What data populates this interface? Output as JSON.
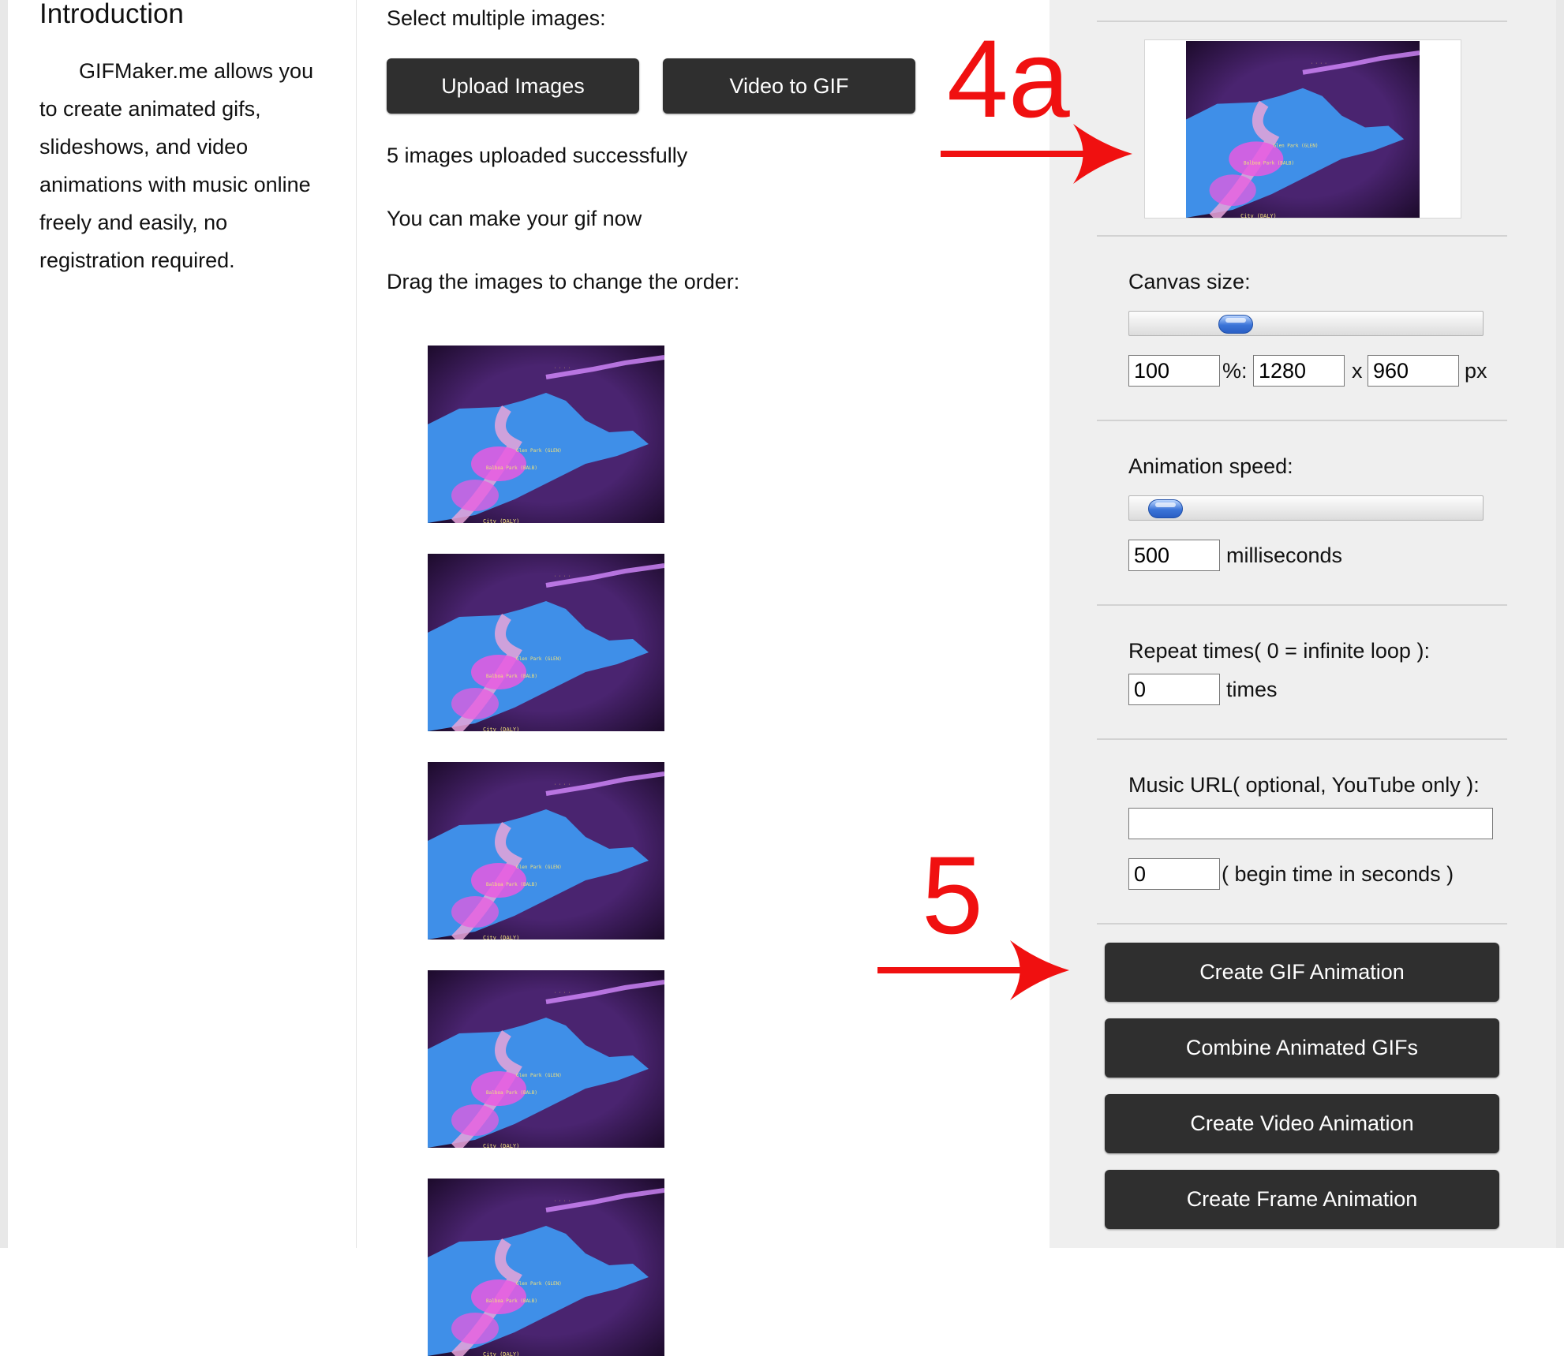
{
  "intro": {
    "heading": "Introduction",
    "text": "GIFMaker.me allows you to create animated gifs, slideshows, and video animations with music online freely and easily, no registration required."
  },
  "upload": {
    "select_label": "Select multiple images:",
    "upload_button": "Upload Images",
    "video_button": "Video to GIF",
    "status_success": "5 images uploaded successfully",
    "status_ready": "You can make your gif now",
    "drag_hint": "Drag the images to change the order:"
  },
  "thumbnails": {
    "count": 5,
    "labels": [
      "Glen Park (GLEN)",
      "Balboa Park (BALB)",
      "City (DALY)"
    ]
  },
  "settings": {
    "canvas_label": "Canvas size:",
    "canvas_percent": "100",
    "canvas_percent_suffix": "%:",
    "canvas_width": "1280",
    "canvas_x": "x",
    "canvas_height": "960",
    "canvas_unit": "px",
    "canvas_slider_value": 0.28,
    "speed_label": "Animation speed:",
    "speed_value": "500",
    "speed_unit": "milliseconds",
    "speed_slider_value": 0.06,
    "repeat_label": "Repeat times( 0 = infinite loop ):",
    "repeat_value": "0",
    "repeat_unit": "times",
    "music_label": "Music URL( optional, YouTube only ):",
    "music_url": "",
    "music_begin": "0",
    "music_begin_suffix": "( begin time in seconds )"
  },
  "actions": {
    "create_gif": "Create GIF Animation",
    "combine_gifs": "Combine Animated GIFs",
    "create_video": "Create Video Animation",
    "create_frame": "Create Frame Animation"
  },
  "annotations": {
    "step_4a": "4a",
    "step_5": "5",
    "color": "#f01010"
  },
  "colors": {
    "button_bg": "#2f2f2f",
    "panel_bg": "#efefef",
    "thumb_bg": "#2b1340",
    "map_blue": "#3f8fe8",
    "route_pink": "#e85be0"
  }
}
